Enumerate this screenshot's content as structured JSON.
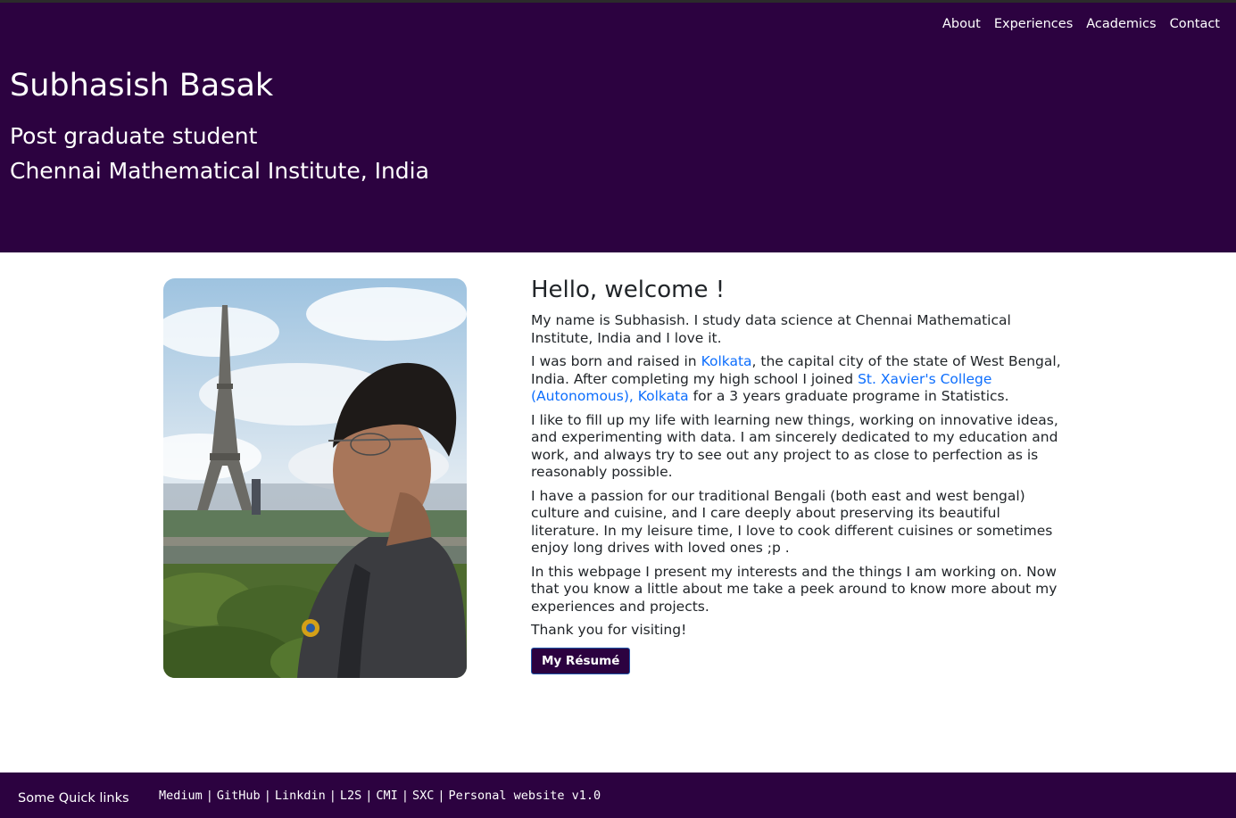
{
  "nav": {
    "items": [
      {
        "label": "About"
      },
      {
        "label": "Experiences"
      },
      {
        "label": "Academics"
      },
      {
        "label": "Contact"
      }
    ]
  },
  "header": {
    "name": "Subhasish Basak",
    "role": "Post graduate student",
    "institute": "Chennai Mathematical Institute, India"
  },
  "main": {
    "heading": "Hello, welcome !",
    "p1": "My name is Subhasish. I study data science at Chennai Mathematical Institute, India and I love it.",
    "p2_a": "I was born and raised in ",
    "p2_link1": "Kolkata",
    "p2_b": ", the capital city of the state of West Bengal, India. After completing my high school I joined ",
    "p2_link2": "St. Xavier's College (Autonomous), Kolkata",
    "p2_c": " for a 3 years graduate programe in Statistics.",
    "p3": "I like to fill up my life with learning new things, working on innovative ideas, and experimenting with data. I am sincerely dedicated to my education and work, and always try to see out any project to as close to perfection as is reasonably possible.",
    "p4": "I have a passion for our traditional Bengali (both east and west bengal) culture and cuisine, and I care deeply about preserving its beautiful literature. In my leisure time, I love to cook different cuisines or sometimes enjoy long drives with loved ones ;p .",
    "p5": "In this webpage I present my interests and the things I am working on. Now that you know a little about me take a peek around to know more about my experiences and projects.",
    "p6": "Thank you for visiting!",
    "resume_label": "My Résumé"
  },
  "footer": {
    "title": "Some Quick links",
    "links": [
      {
        "label": "Medium"
      },
      {
        "label": "GitHub"
      },
      {
        "label": "Linkdin"
      },
      {
        "label": "L2S"
      },
      {
        "label": "CMI"
      },
      {
        "label": "SXC"
      }
    ],
    "separator": "|",
    "version": "Personal website v1.0"
  },
  "colors": {
    "brand": "#2c0240",
    "link": "#0d6efd"
  }
}
